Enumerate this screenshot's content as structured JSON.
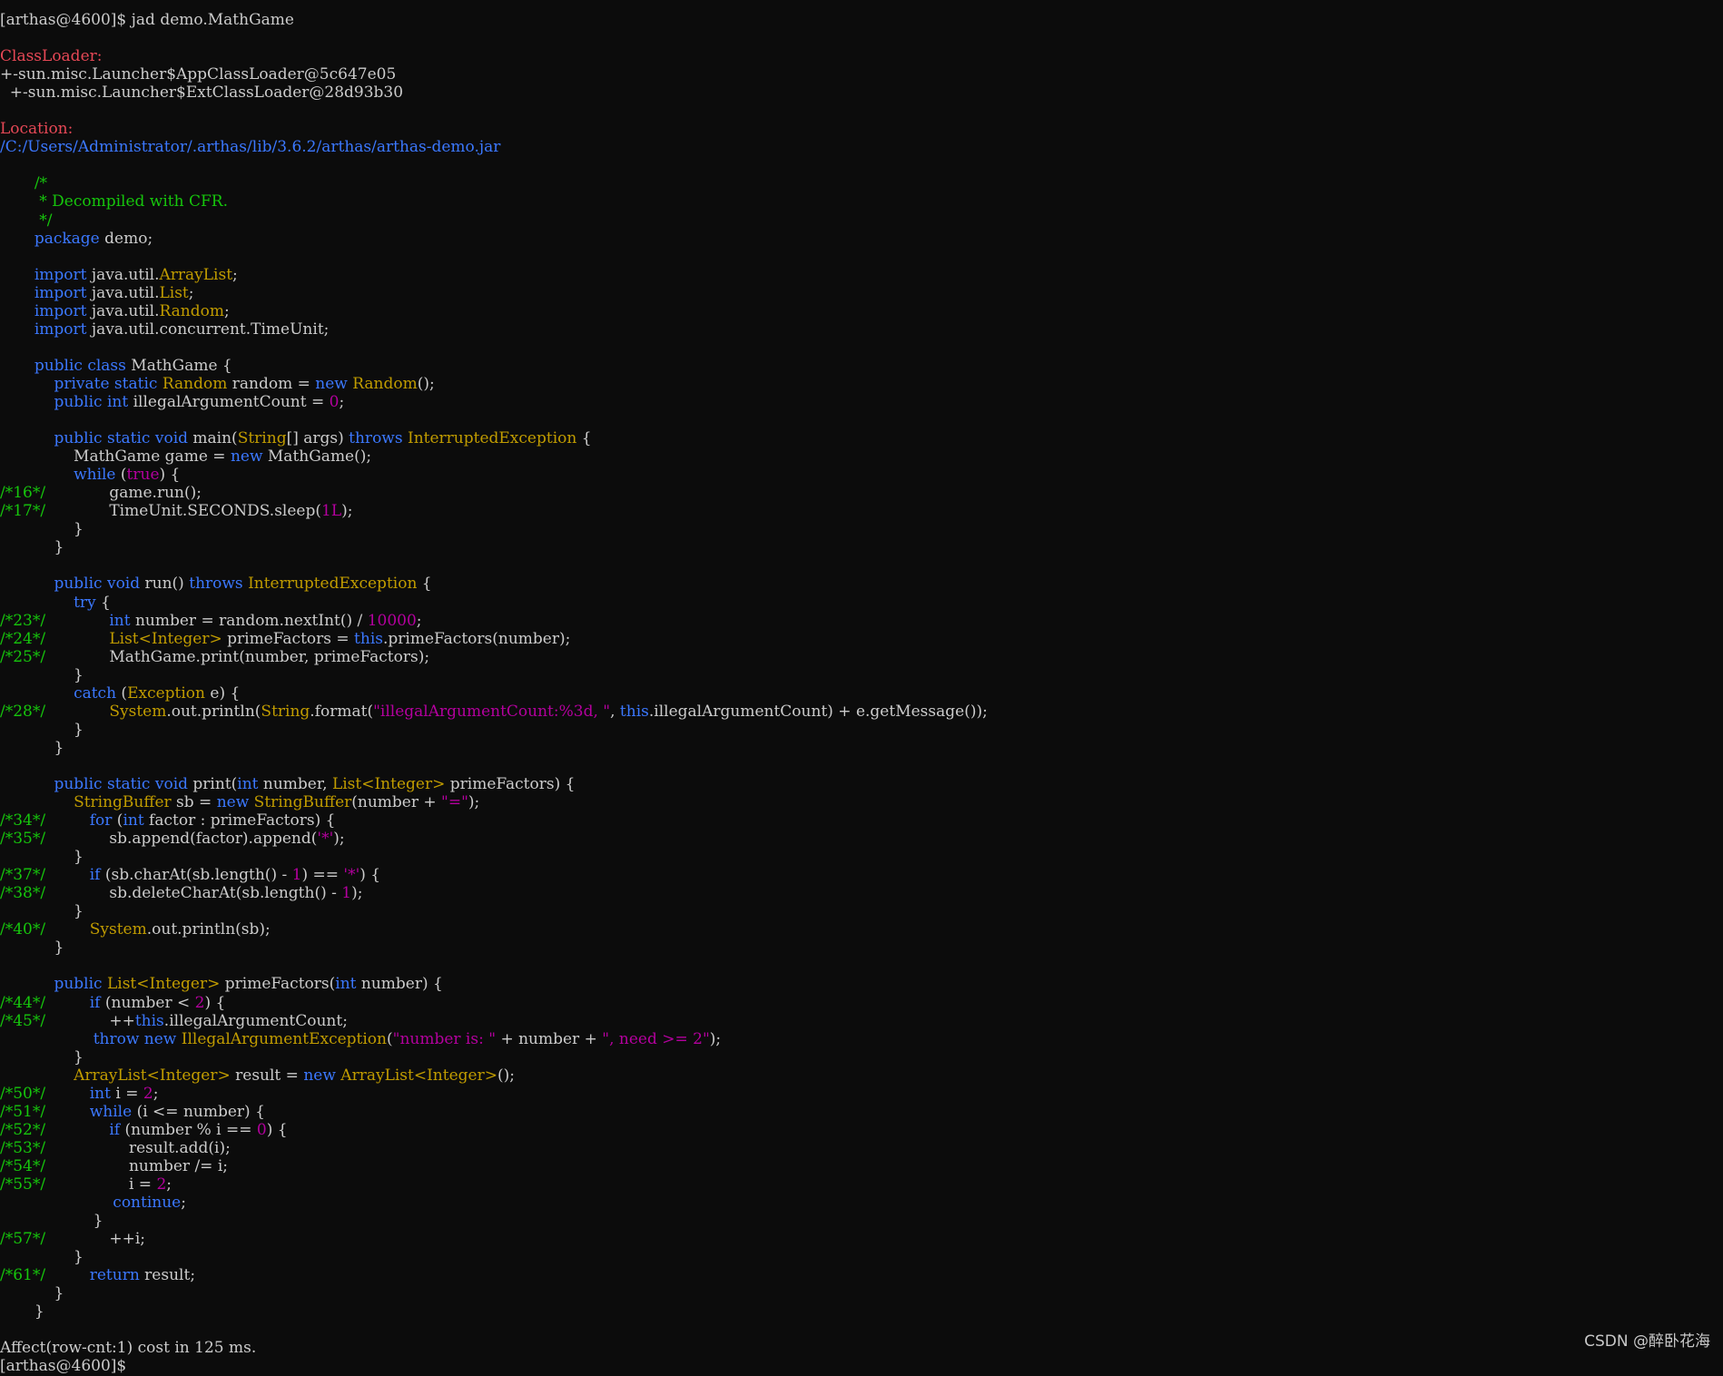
{
  "terminal": {
    "colors": {
      "r": "#e74856",
      "b": "#3b78ff",
      "g": "#16c60c",
      "y": "#c19c00",
      "m": "#b4009e",
      "w": "#cccccc"
    },
    "lines": [
      [
        [
          "w",
          "[arthas@4600]$ jad demo.MathGame"
        ]
      ],
      [],
      [
        [
          "r",
          "ClassLoader:"
        ]
      ],
      [
        [
          "w",
          "+-sun.misc.Launcher$AppClassLoader@5c647e05"
        ]
      ],
      [
        [
          "w",
          "  +-sun.misc.Launcher$ExtClassLoader@28d93b30"
        ]
      ],
      [],
      [
        [
          "r",
          "Location:"
        ]
      ],
      [
        [
          "b",
          "/C:/Users/Administrator/.arthas/lib/3.6.2/arthas/arthas-demo.jar"
        ]
      ],
      [],
      [
        [
          "g",
          "       /*"
        ]
      ],
      [
        [
          "g",
          "        * Decompiled with CFR."
        ]
      ],
      [
        [
          "g",
          "        */"
        ]
      ],
      [
        [
          "w",
          "       "
        ],
        [
          "b",
          "package"
        ],
        [
          "w",
          " demo;"
        ]
      ],
      [],
      [
        [
          "w",
          "       "
        ],
        [
          "b",
          "import"
        ],
        [
          "w",
          " java.util."
        ],
        [
          "y",
          "ArrayList"
        ],
        [
          "w",
          ";"
        ]
      ],
      [
        [
          "w",
          "       "
        ],
        [
          "b",
          "import"
        ],
        [
          "w",
          " java.util."
        ],
        [
          "y",
          "List"
        ],
        [
          "w",
          ";"
        ]
      ],
      [
        [
          "w",
          "       "
        ],
        [
          "b",
          "import"
        ],
        [
          "w",
          " java.util."
        ],
        [
          "y",
          "Random"
        ],
        [
          "w",
          ";"
        ]
      ],
      [
        [
          "w",
          "       "
        ],
        [
          "b",
          "import"
        ],
        [
          "w",
          " java.util.concurrent.TimeUnit;"
        ]
      ],
      [],
      [
        [
          "w",
          "       "
        ],
        [
          "b",
          "public class"
        ],
        [
          "w",
          " MathGame {"
        ]
      ],
      [
        [
          "w",
          "           "
        ],
        [
          "b",
          "private static"
        ],
        [
          "w",
          " "
        ],
        [
          "y",
          "Random"
        ],
        [
          "w",
          " random = "
        ],
        [
          "b",
          "new"
        ],
        [
          "w",
          " "
        ],
        [
          "y",
          "Random"
        ],
        [
          "w",
          "();"
        ]
      ],
      [
        [
          "w",
          "           "
        ],
        [
          "b",
          "public int"
        ],
        [
          "w",
          " illegalArgumentCount = "
        ],
        [
          "m",
          "0"
        ],
        [
          "w",
          ";"
        ]
      ],
      [],
      [
        [
          "w",
          "           "
        ],
        [
          "b",
          "public static void"
        ],
        [
          "w",
          " main("
        ],
        [
          "y",
          "String"
        ],
        [
          "w",
          "[] args) "
        ],
        [
          "b",
          "throws"
        ],
        [
          "w",
          " "
        ],
        [
          "y",
          "InterruptedException"
        ],
        [
          "w",
          " {"
        ]
      ],
      [
        [
          "w",
          "               MathGame game = "
        ],
        [
          "b",
          "new"
        ],
        [
          "w",
          " MathGame();"
        ]
      ],
      [
        [
          "w",
          "               "
        ],
        [
          "b",
          "while"
        ],
        [
          "w",
          " ("
        ],
        [
          "m",
          "true"
        ],
        [
          "w",
          ") {"
        ]
      ],
      [
        [
          "g",
          "/*16*/"
        ],
        [
          "w",
          "             game.run();"
        ]
      ],
      [
        [
          "g",
          "/*17*/"
        ],
        [
          "w",
          "             TimeUnit.SECONDS.sleep("
        ],
        [
          "m",
          "1L"
        ],
        [
          "w",
          ");"
        ]
      ],
      [
        [
          "w",
          "               }"
        ]
      ],
      [
        [
          "w",
          "           }"
        ]
      ],
      [],
      [
        [
          "w",
          "           "
        ],
        [
          "b",
          "public void"
        ],
        [
          "w",
          " run() "
        ],
        [
          "b",
          "throws"
        ],
        [
          "w",
          " "
        ],
        [
          "y",
          "InterruptedException"
        ],
        [
          "w",
          " {"
        ]
      ],
      [
        [
          "w",
          "               "
        ],
        [
          "b",
          "try"
        ],
        [
          "w",
          " {"
        ]
      ],
      [
        [
          "g",
          "/*23*/"
        ],
        [
          "w",
          "             "
        ],
        [
          "b",
          "int"
        ],
        [
          "w",
          " number = random.nextInt() / "
        ],
        [
          "m",
          "10000"
        ],
        [
          "w",
          ";"
        ]
      ],
      [
        [
          "g",
          "/*24*/"
        ],
        [
          "w",
          "             "
        ],
        [
          "y",
          "List<Integer>"
        ],
        [
          "w",
          " primeFactors = "
        ],
        [
          "b",
          "this"
        ],
        [
          "w",
          ".primeFactors(number);"
        ]
      ],
      [
        [
          "g",
          "/*25*/"
        ],
        [
          "w",
          "             MathGame.print(number, primeFactors);"
        ]
      ],
      [
        [
          "w",
          "               }"
        ]
      ],
      [
        [
          "w",
          "               "
        ],
        [
          "b",
          "catch"
        ],
        [
          "w",
          " ("
        ],
        [
          "y",
          "Exception"
        ],
        [
          "w",
          " e) {"
        ]
      ],
      [
        [
          "g",
          "/*28*/"
        ],
        [
          "w",
          "             "
        ],
        [
          "y",
          "System"
        ],
        [
          "w",
          ".out.println("
        ],
        [
          "y",
          "String"
        ],
        [
          "w",
          ".format("
        ],
        [
          "m",
          "\"illegalArgumentCount:%3d, \""
        ],
        [
          "w",
          ", "
        ],
        [
          "b",
          "this"
        ],
        [
          "w",
          ".illegalArgumentCount) + e.getMessage());"
        ]
      ],
      [
        [
          "w",
          "               }"
        ]
      ],
      [
        [
          "w",
          "           }"
        ]
      ],
      [],
      [
        [
          "w",
          "           "
        ],
        [
          "b",
          "public static void"
        ],
        [
          "w",
          " print("
        ],
        [
          "b",
          "int"
        ],
        [
          "w",
          " number, "
        ],
        [
          "y",
          "List<Integer>"
        ],
        [
          "w",
          " primeFactors) {"
        ]
      ],
      [
        [
          "w",
          "               "
        ],
        [
          "y",
          "StringBuffer"
        ],
        [
          "w",
          " sb = "
        ],
        [
          "b",
          "new"
        ],
        [
          "w",
          " "
        ],
        [
          "y",
          "StringBuffer"
        ],
        [
          "w",
          "(number + "
        ],
        [
          "m",
          "\"=\""
        ],
        [
          "w",
          ");"
        ]
      ],
      [
        [
          "g",
          "/*34*/"
        ],
        [
          "w",
          "         "
        ],
        [
          "b",
          "for"
        ],
        [
          "w",
          " ("
        ],
        [
          "b",
          "int"
        ],
        [
          "w",
          " factor : primeFactors) {"
        ]
      ],
      [
        [
          "g",
          "/*35*/"
        ],
        [
          "w",
          "             sb.append(factor).append("
        ],
        [
          "m",
          "'*'"
        ],
        [
          "w",
          ");"
        ]
      ],
      [
        [
          "w",
          "               }"
        ]
      ],
      [
        [
          "g",
          "/*37*/"
        ],
        [
          "w",
          "         "
        ],
        [
          "b",
          "if"
        ],
        [
          "w",
          " (sb.charAt(sb.length() - "
        ],
        [
          "m",
          "1"
        ],
        [
          "w",
          ") == "
        ],
        [
          "m",
          "'*'"
        ],
        [
          "w",
          ") {"
        ]
      ],
      [
        [
          "g",
          "/*38*/"
        ],
        [
          "w",
          "             sb.deleteCharAt(sb.length() - "
        ],
        [
          "m",
          "1"
        ],
        [
          "w",
          ");"
        ]
      ],
      [
        [
          "w",
          "               }"
        ]
      ],
      [
        [
          "g",
          "/*40*/"
        ],
        [
          "w",
          "         "
        ],
        [
          "y",
          "System"
        ],
        [
          "w",
          ".out.println(sb);"
        ]
      ],
      [
        [
          "w",
          "           }"
        ]
      ],
      [],
      [
        [
          "w",
          "           "
        ],
        [
          "b",
          "public"
        ],
        [
          "w",
          " "
        ],
        [
          "y",
          "List<Integer>"
        ],
        [
          "w",
          " primeFactors("
        ],
        [
          "b",
          "int"
        ],
        [
          "w",
          " number) {"
        ]
      ],
      [
        [
          "g",
          "/*44*/"
        ],
        [
          "w",
          "         "
        ],
        [
          "b",
          "if"
        ],
        [
          "w",
          " (number < "
        ],
        [
          "m",
          "2"
        ],
        [
          "w",
          ") {"
        ]
      ],
      [
        [
          "g",
          "/*45*/"
        ],
        [
          "w",
          "             ++"
        ],
        [
          "b",
          "this"
        ],
        [
          "w",
          ".illegalArgumentCount;"
        ]
      ],
      [
        [
          "w",
          "                   "
        ],
        [
          "b",
          "throw new"
        ],
        [
          "w",
          " "
        ],
        [
          "y",
          "IllegalArgumentException"
        ],
        [
          "w",
          "("
        ],
        [
          "m",
          "\"number is: \""
        ],
        [
          "w",
          " + number + "
        ],
        [
          "m",
          "\", need >= 2\""
        ],
        [
          "w",
          ");"
        ]
      ],
      [
        [
          "w",
          "               }"
        ]
      ],
      [
        [
          "w",
          "               "
        ],
        [
          "y",
          "ArrayList<Integer>"
        ],
        [
          "w",
          " result = "
        ],
        [
          "b",
          "new"
        ],
        [
          "w",
          " "
        ],
        [
          "y",
          "ArrayList<Integer>"
        ],
        [
          "w",
          "();"
        ]
      ],
      [
        [
          "g",
          "/*50*/"
        ],
        [
          "w",
          "         "
        ],
        [
          "b",
          "int"
        ],
        [
          "w",
          " i = "
        ],
        [
          "m",
          "2"
        ],
        [
          "w",
          ";"
        ]
      ],
      [
        [
          "g",
          "/*51*/"
        ],
        [
          "w",
          "         "
        ],
        [
          "b",
          "while"
        ],
        [
          "w",
          " (i <= number) {"
        ]
      ],
      [
        [
          "g",
          "/*52*/"
        ],
        [
          "w",
          "             "
        ],
        [
          "b",
          "if"
        ],
        [
          "w",
          " (number % i == "
        ],
        [
          "m",
          "0"
        ],
        [
          "w",
          ") {"
        ]
      ],
      [
        [
          "g",
          "/*53*/"
        ],
        [
          "w",
          "                 result.add(i);"
        ]
      ],
      [
        [
          "g",
          "/*54*/"
        ],
        [
          "w",
          "                 number /= i;"
        ]
      ],
      [
        [
          "g",
          "/*55*/"
        ],
        [
          "w",
          "                 i = "
        ],
        [
          "m",
          "2"
        ],
        [
          "w",
          ";"
        ]
      ],
      [
        [
          "w",
          "                       "
        ],
        [
          "b",
          "continue"
        ],
        [
          "w",
          ";"
        ]
      ],
      [
        [
          "w",
          "                   }"
        ]
      ],
      [
        [
          "g",
          "/*57*/"
        ],
        [
          "w",
          "             ++i;"
        ]
      ],
      [
        [
          "w",
          "               }"
        ]
      ],
      [
        [
          "g",
          "/*61*/"
        ],
        [
          "w",
          "         "
        ],
        [
          "b",
          "return"
        ],
        [
          "w",
          " result;"
        ]
      ],
      [
        [
          "w",
          "           }"
        ]
      ],
      [
        [
          "w",
          "       }"
        ]
      ],
      [],
      [
        [
          "w",
          "Affect(row-cnt:1) cost in 125 ms."
        ]
      ],
      [
        [
          "w",
          "[arthas@4600]$"
        ]
      ]
    ]
  },
  "watermark": "CSDN @醉卧花海"
}
